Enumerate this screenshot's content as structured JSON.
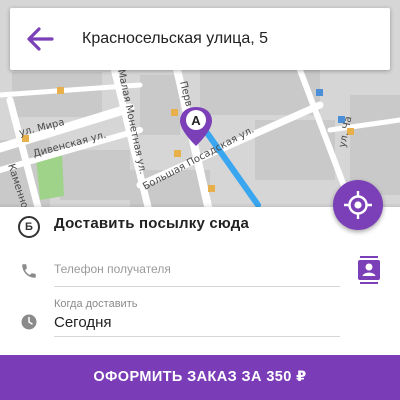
{
  "header": {
    "address": "Красносельская улица, 5"
  },
  "map": {
    "streets": {
      "mira": "ул. Мира",
      "divenskaya": "Дивенская ул.",
      "kamennoostrovsky": "Каменноостр",
      "malaya_monetnaya": "Малая Монетная ул.",
      "pervaya": "Перв",
      "bolshaya_posadskaya": "Большая Посадская ул.",
      "ch": "ул. Ча"
    },
    "marker_label": "A"
  },
  "form": {
    "point_badge": "Б",
    "title": "Доставить посылку сюда",
    "phone_placeholder": "Телефон получателя",
    "when_label": "Когда доставить",
    "when_value": "Сегодня"
  },
  "order_button": {
    "label": "ОФОРМИТЬ ЗАКАЗ ЗА 350 ₽"
  },
  "colors": {
    "accent": "#7b3fb8",
    "route": "#3aa6f0"
  }
}
